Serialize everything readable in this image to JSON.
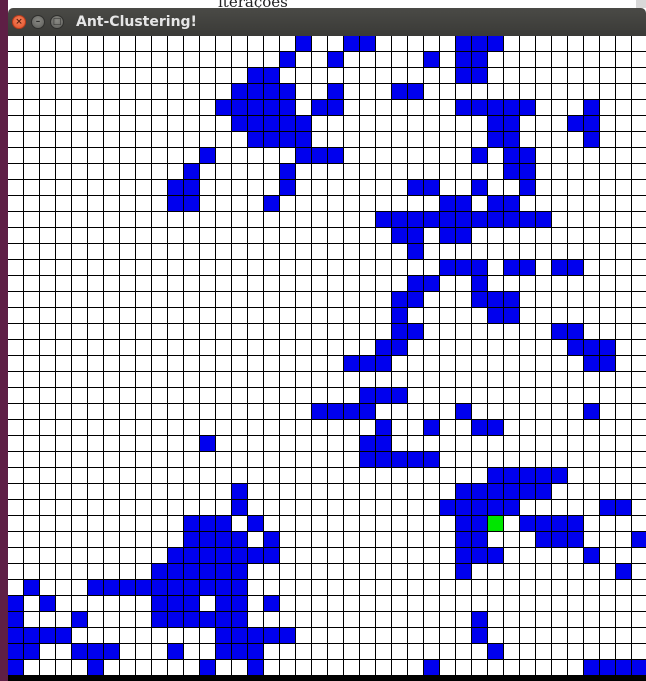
{
  "background": {
    "partial_text": "iterações"
  },
  "window": {
    "title": "Ant-Clustering!",
    "buttons": {
      "close_icon": "×",
      "minimize_icon": "–",
      "maximize_icon": "□"
    }
  },
  "colors": {
    "empty_cell": "#ffffff",
    "item_cell": "#0000ee",
    "ant_cell": "#00e600",
    "grid_lines": "#000000"
  },
  "grid": {
    "columns": 40,
    "visible_rows": 40,
    "legend": {
      ".": "empty",
      "B": "item",
      "G": "ant"
    },
    "rows": [
      "..................B..BB.....BBB.........",
      ".................B..B.....B.BB..........",
      "...............BB...........BB..........",
      "..............BBBB..B...BB..............",
      ".............BBBBB.BB.......BBBBB...B...",
      "..............BBBBB...........BB...BB...",
      "...............BBBB...........BB....B...",
      "............B.....BBB........B.BB.......",
      "...........B.....B.............BB.......",
      "..........BB.....B.......BB..B..B.......",
      "..........BB....B..........BB.BB........",
      ".......................BBBBBBBBBBB......",
      "........................BB.BB...........",
      ".........................B..............",
      "...........................BBB.BB.BB....",
      ".........................BB..B..........",
      "........................BB...BBB........",
      "........................B.....BB........",
      "........................BB........BB....",
      ".......................BB..........BBB..",
      ".....................BBB............BB..",
      "........................................",
      "......................BBB...............",
      "...................BBBB.....B.......B...",
      ".......................B..B..BB.........",
      "............B.........BB................",
      "......................BBBBB.............",
      "..............................BBBBB.....",
      "..............B.............BBBBBB......",
      "..............B............BBBBB.....BB.",
      "...........BBB.B............BBG.BBBB....",
      "...........BBBB.B...........BB...BBB...B",
      "..........BBBBBBB...........BBB.....B...",
      ".........BBBBBB.............B.........B.",
      ".B...BBBBBBBBBB.........................",
      "B.B......BBB.BB.B.......................",
      "B...B....BBBBBB..............B..........",
      "BBBB.........BBBBB...........B..........",
      "BB..BBB...B..BBB..............B.........",
      "B....B......B..B..........B.........BBBB"
    ]
  }
}
